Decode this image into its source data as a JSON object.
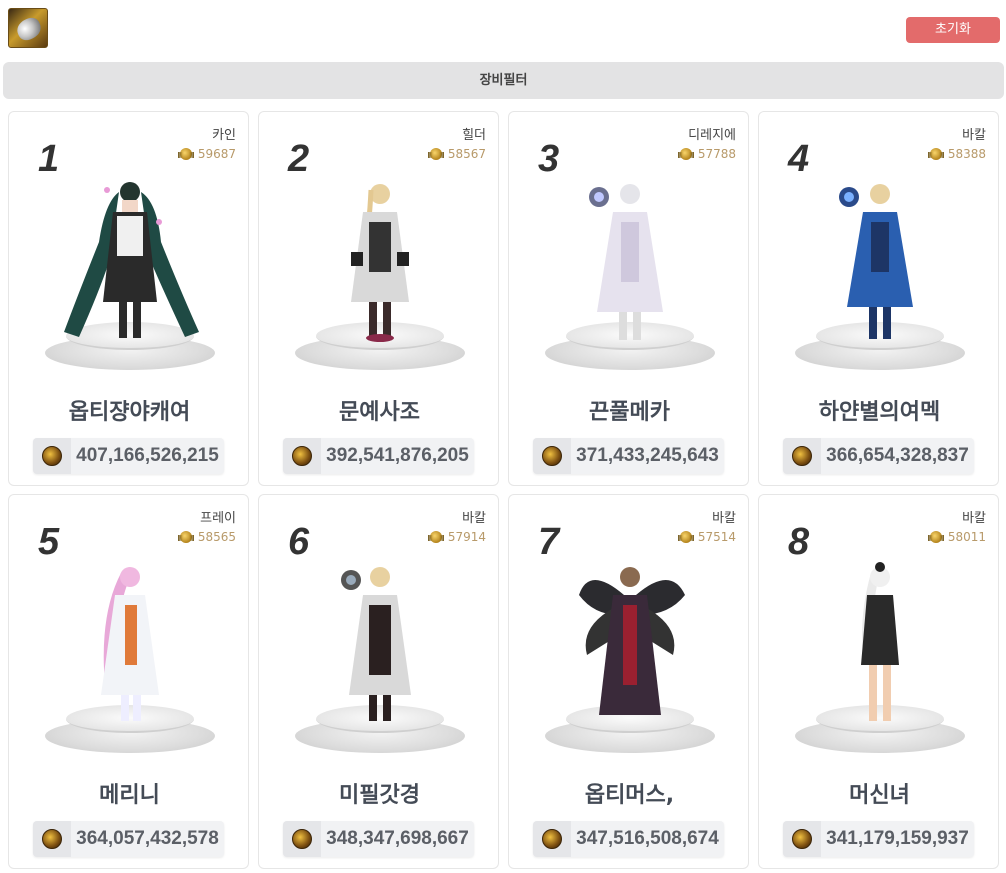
{
  "header": {
    "logo_icon": "character-class-icon",
    "reset_label": "초기화"
  },
  "filter": {
    "label": "장비필터"
  },
  "colors": {
    "reset": "#e36b6b",
    "rank_text": "#333333",
    "fame_text": "#b89a6a"
  },
  "cards": [
    {
      "rank": "1",
      "server": "카인",
      "fame": "59687",
      "name": "옵티쟝야캐여",
      "power": "407,166,526,215"
    },
    {
      "rank": "2",
      "server": "힐더",
      "fame": "58567",
      "name": "문예사조",
      "power": "392,541,876,205"
    },
    {
      "rank": "3",
      "server": "디레지에",
      "fame": "57788",
      "name": "끈풀메카",
      "power": "371,433,245,643"
    },
    {
      "rank": "4",
      "server": "바칼",
      "fame": "58388",
      "name": "하얀별의여멕",
      "power": "366,654,328,837"
    },
    {
      "rank": "5",
      "server": "프레이",
      "fame": "58565",
      "name": "메리니",
      "power": "364,057,432,578"
    },
    {
      "rank": "6",
      "server": "바칼",
      "fame": "57914",
      "name": "미필갓경",
      "power": "348,347,698,667"
    },
    {
      "rank": "7",
      "server": "바칼",
      "fame": "57514",
      "name": "옵티머스,",
      "power": "347,516,508,674"
    },
    {
      "rank": "8",
      "server": "바칼",
      "fame": "58011",
      "name": "머신녀",
      "power": "341,179,159,937"
    }
  ]
}
